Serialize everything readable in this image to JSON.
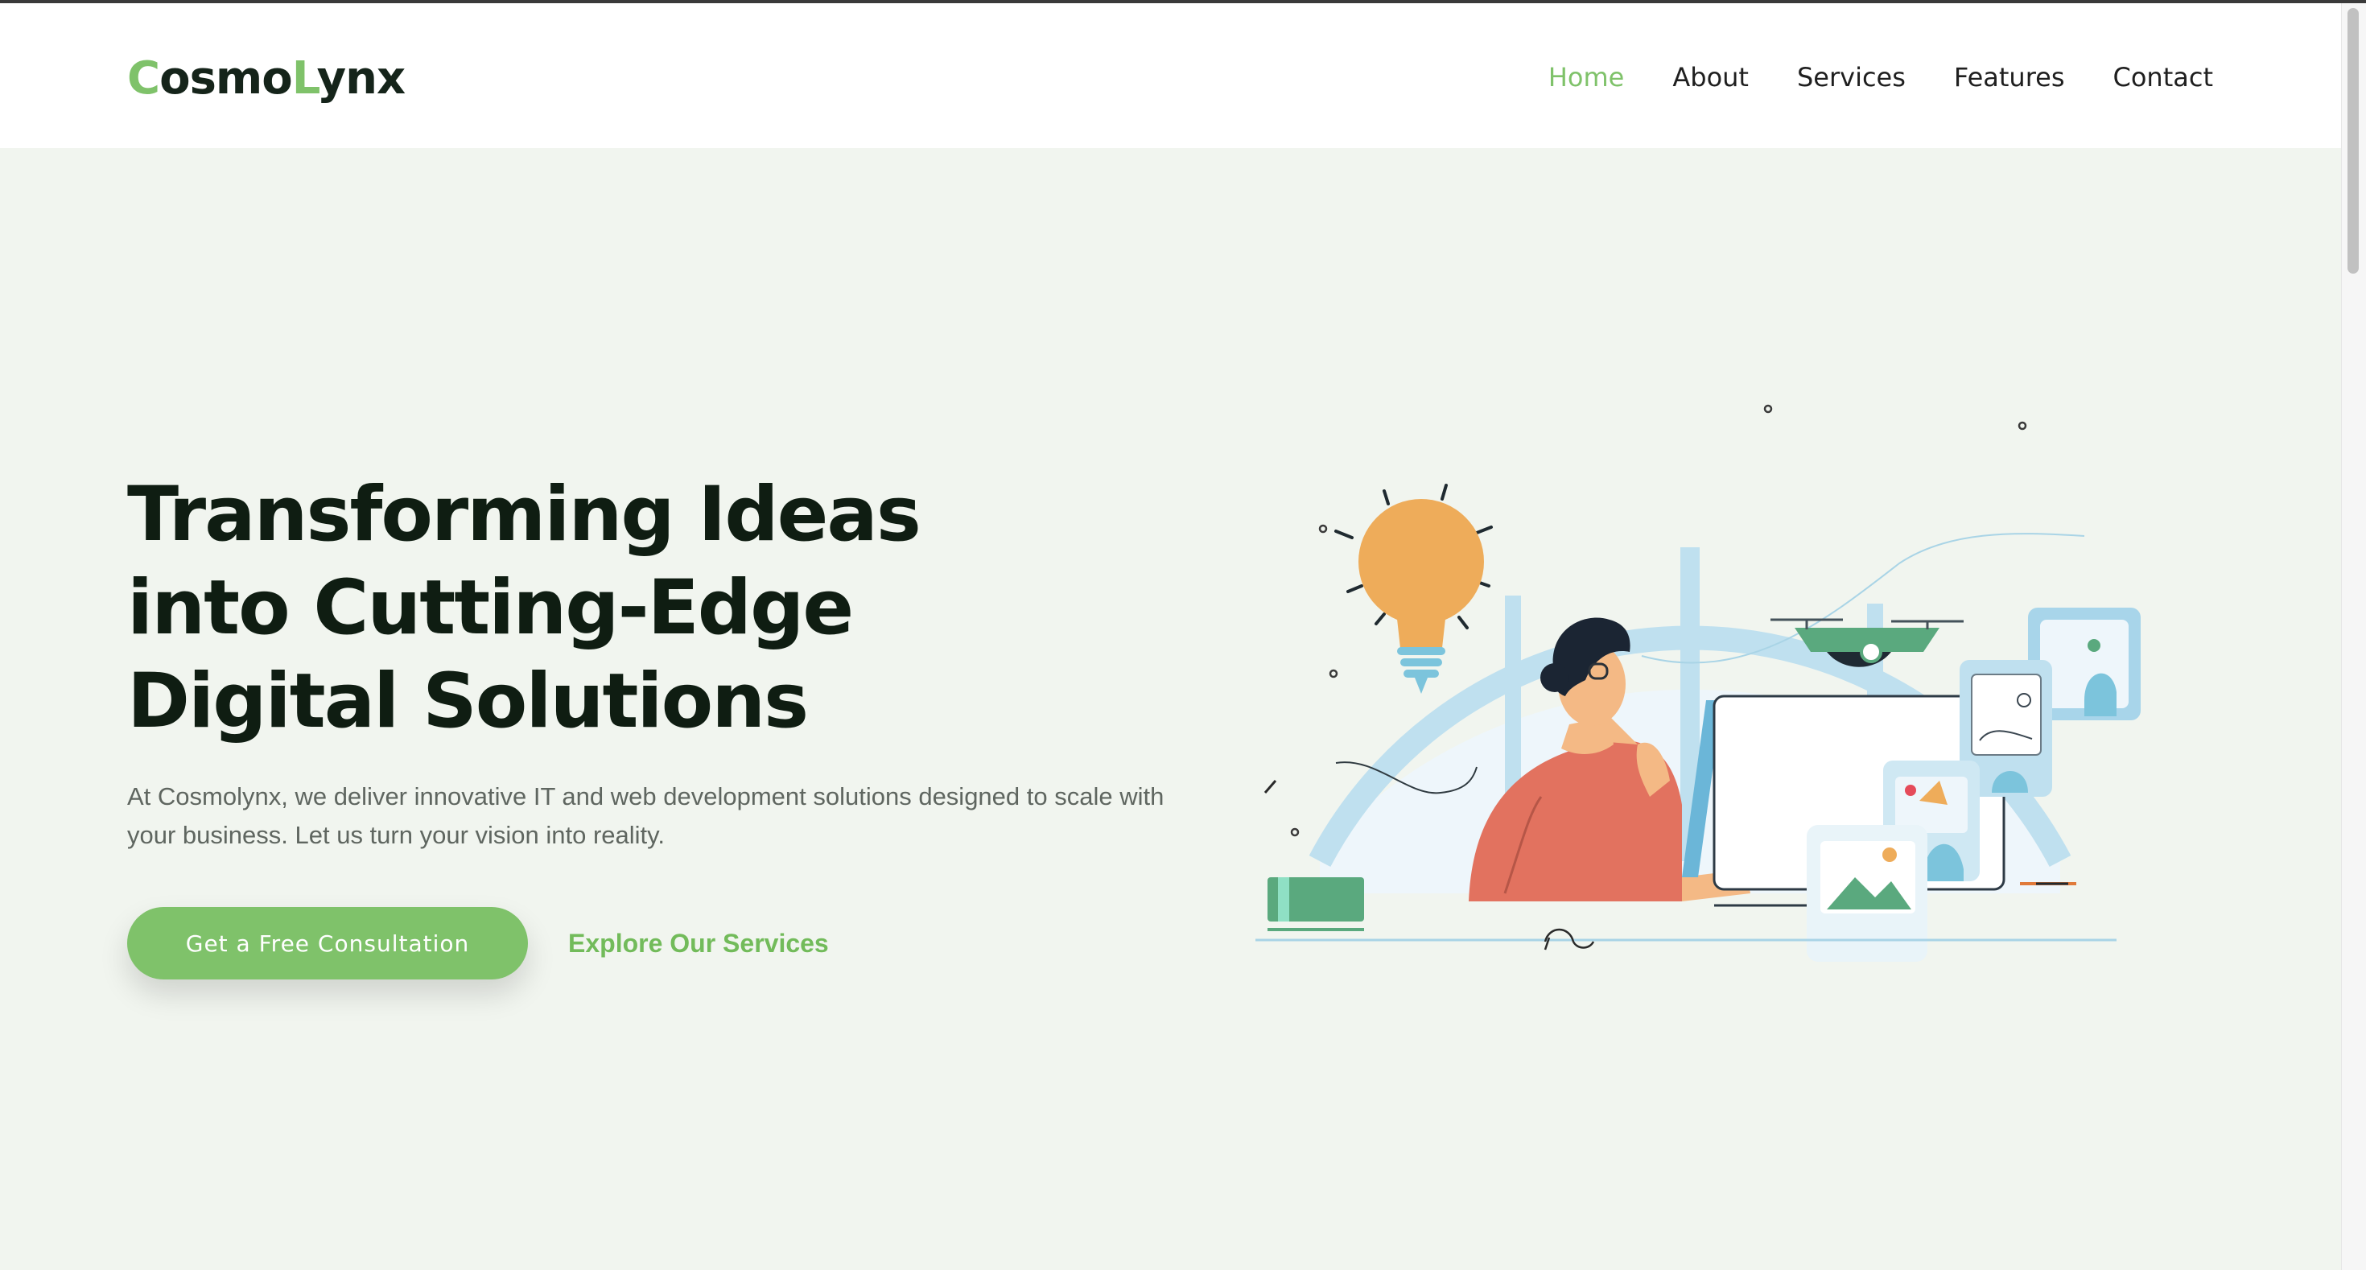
{
  "brand": {
    "logo_part1_initial": "C",
    "logo_part1_rest": "osmo",
    "logo_part2_initial": "L",
    "logo_part2_rest": "ynx"
  },
  "nav": {
    "items": [
      {
        "label": "Home",
        "active": true
      },
      {
        "label": "About",
        "active": false
      },
      {
        "label": "Services",
        "active": false
      },
      {
        "label": "Features",
        "active": false
      },
      {
        "label": "Contact",
        "active": false
      }
    ]
  },
  "hero": {
    "title_line1": "Transforming Ideas",
    "title_line2": "into Cutting-Edge",
    "title_line3": "Digital Solutions",
    "description": "At Cosmolynx, we deliver innovative IT and web development solutions designed to scale with your business. Let us turn your vision into reality.",
    "primary_cta": "Get a Free Consultation",
    "secondary_cta": "Explore Our Services"
  },
  "colors": {
    "accent": "#7fc26a",
    "background": "#f1f5ef",
    "heading": "#0f1d12",
    "body_text": "#5f6660"
  },
  "icons": {
    "illustration": "developer-at-desk-illustration"
  }
}
